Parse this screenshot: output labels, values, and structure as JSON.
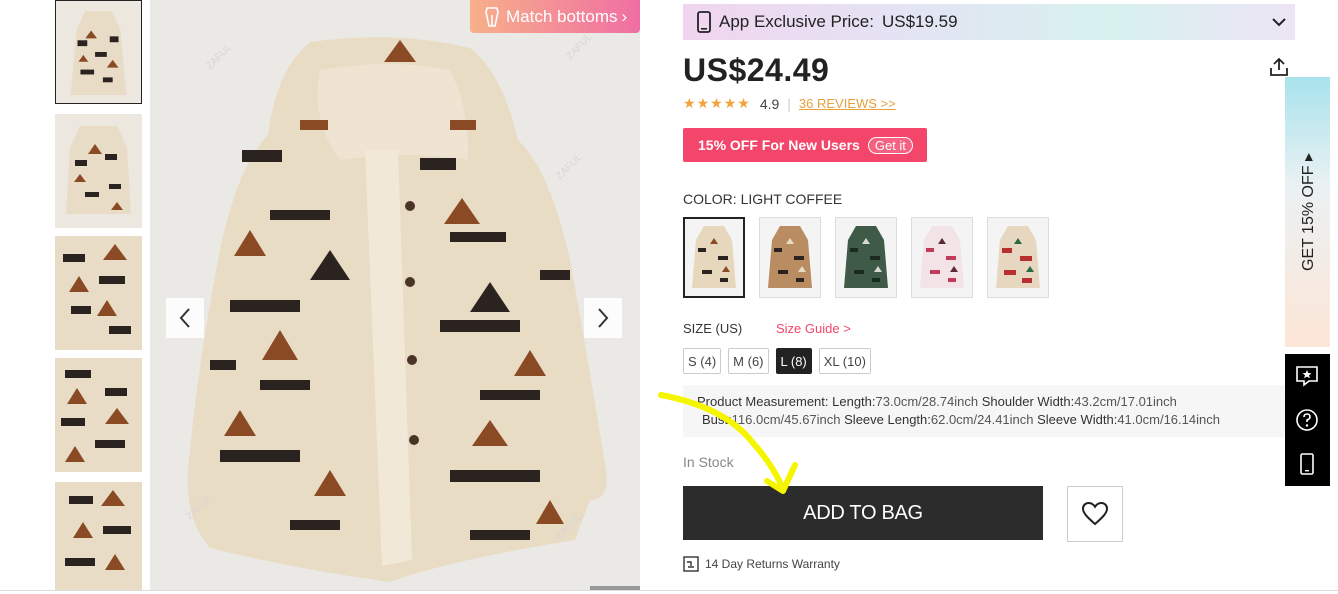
{
  "gallery": {
    "match_bottoms_label": "Match bottoms",
    "thumbnail_count": 5
  },
  "app_banner": {
    "label": "App Exclusive Price:",
    "price": "US$19.59"
  },
  "product": {
    "price": "US$24.49",
    "rating_score": "4.9",
    "rating_stars": 5,
    "reviews_link": "36 REVIEWS >>"
  },
  "coupon": {
    "text": "15% OFF For New Users",
    "cta": "Get it"
  },
  "color": {
    "label": "COLOR: LIGHT COFFEE",
    "swatches": [
      "light-coffee",
      "coffee",
      "dark-green",
      "pink",
      "red"
    ]
  },
  "size": {
    "label": "SIZE (US)",
    "guide_link": "Size Guide >",
    "options": [
      "S (4)",
      "M (6)",
      "L (8)",
      "XL (10)"
    ],
    "selected": "L (8)"
  },
  "measurement": {
    "title": "Product Measurement:",
    "length_label": "Length:",
    "length_value": "73.0cm/28.74inch",
    "shoulder_label": "Shoulder Width:",
    "shoulder_value": "43.2cm/17.01inch",
    "bust_label": "Bust:",
    "bust_value": "116.0cm/45.67inch",
    "sleeve_length_label": "Sleeve Length:",
    "sleeve_length_value": "62.0cm/24.41inch",
    "sleeve_width_label": "Sleeve Width:",
    "sleeve_width_value": "41.0cm/16.14inch"
  },
  "stock_status": "In Stock",
  "add_to_bag_label": "ADD TO BAG",
  "returns_text": "14 Day Returns Warranty",
  "side_promo_text": "GET 15% OFF ▸",
  "colors": {
    "coupon": "#f4466a",
    "rating_star": "#f2a33a",
    "button": "#2c2c2c",
    "annotation": "#f5f500"
  }
}
